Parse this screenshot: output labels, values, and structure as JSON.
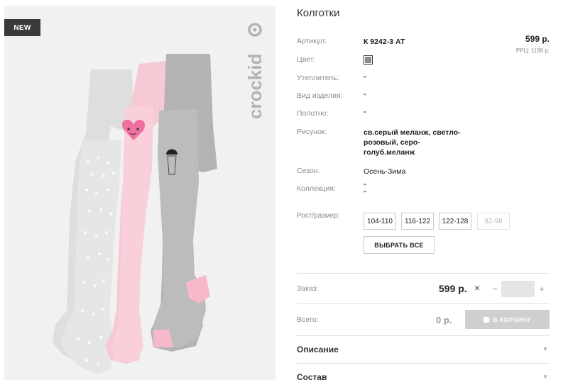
{
  "gallery": {
    "badge": "NEW",
    "brand": "crockid"
  },
  "product": {
    "title": "Колготки",
    "price": "599 р.",
    "rrp": "РРЦ: 1199 р.",
    "color_swatch": "#8c8c8c"
  },
  "attributes": [
    {
      "label": "Артикул:",
      "value": "К 9242-3 АТ"
    },
    {
      "label": "Цвет:",
      "value": ""
    },
    {
      "label": "Утеплитель:",
      "value": "\""
    },
    {
      "label": "Вид изделия:",
      "value": "\""
    },
    {
      "label": "Полотно:",
      "value": "\""
    },
    {
      "label": "Рисунок:",
      "value": "св.серый меланж, светло-розовый, серо-голуб.меланж"
    },
    {
      "label": "Сезон:",
      "value": "Осень-Зима"
    },
    {
      "label": "Коллекция:",
      "value": "\"\n\""
    }
  ],
  "sizes": {
    "label": "Рост/размер:",
    "options": [
      "104-110",
      "116-122",
      "122-128",
      "92-98"
    ],
    "select_all": "ВЫБРАТЬ ВСЕ"
  },
  "order": {
    "label": "Заказ:",
    "price": "599 р.",
    "times": "×",
    "minus": "−",
    "plus": "+",
    "quantity": ""
  },
  "total": {
    "label": "Всего:",
    "value": "0 р.",
    "cart_button": "В КОРЗИНУ"
  },
  "accordion": [
    {
      "title": "Описание"
    },
    {
      "title": "Состав"
    }
  ]
}
